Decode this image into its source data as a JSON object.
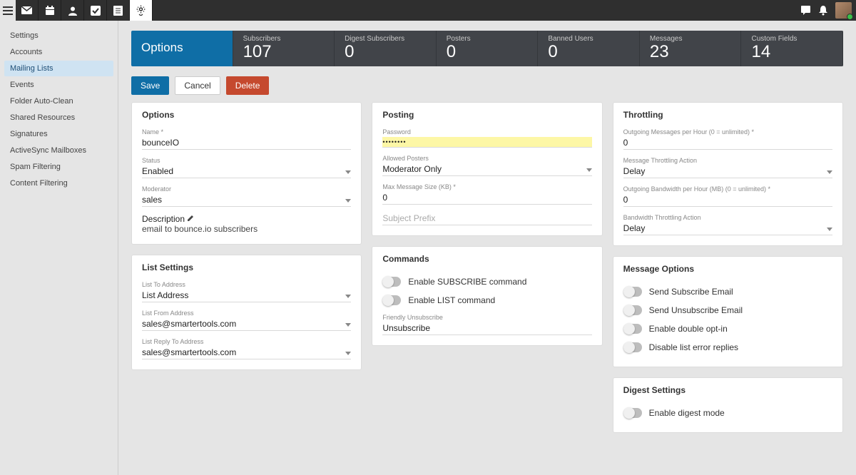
{
  "header": {
    "title": "Options",
    "stats": [
      {
        "label": "Subscribers",
        "value": "107"
      },
      {
        "label": "Digest Subscribers",
        "value": "0"
      },
      {
        "label": "Posters",
        "value": "0"
      },
      {
        "label": "Banned Users",
        "value": "0"
      },
      {
        "label": "Messages",
        "value": "23"
      },
      {
        "label": "Custom Fields",
        "value": "14"
      }
    ]
  },
  "actions": {
    "save": "Save",
    "cancel": "Cancel",
    "delete": "Delete"
  },
  "sidebar": {
    "items": [
      "Settings",
      "Accounts",
      "Mailing Lists",
      "Events",
      "Folder Auto-Clean",
      "Shared Resources",
      "Signatures",
      "ActiveSync Mailboxes",
      "Spam Filtering",
      "Content Filtering"
    ],
    "selectedIndex": 2
  },
  "options": {
    "title": "Options",
    "name_label": "Name *",
    "name": "bounceIO",
    "status_label": "Status",
    "status": "Enabled",
    "moderator_label": "Moderator",
    "moderator": "sales",
    "description_label": "Description",
    "description": "email to bounce.io subscribers"
  },
  "list": {
    "title": "List Settings",
    "to_label": "List To Address",
    "to": "List Address",
    "from_label": "List From Address",
    "from": "sales@smartertools.com",
    "reply_label": "List Reply To Address",
    "reply": "sales@smartertools.com"
  },
  "posting": {
    "title": "Posting",
    "password_label": "Password",
    "password": "••••••••",
    "posters_label": "Allowed Posters",
    "posters": "Moderator Only",
    "max_label": "Max Message Size (KB) *",
    "max": "0",
    "prefix_label": "",
    "prefix_placeholder": "Subject Prefix"
  },
  "commands": {
    "title": "Commands",
    "subscribe": "Enable SUBSCRIBE command",
    "list": "Enable LIST command",
    "friendly_label": "Friendly Unsubscribe",
    "friendly": "Unsubscribe"
  },
  "throttling": {
    "title": "Throttling",
    "out_msg_label": "Outgoing Messages per Hour (0 = unlimited) *",
    "out_msg": "0",
    "msg_action_label": "Message Throttling Action",
    "msg_action": "Delay",
    "out_bw_label": "Outgoing Bandwidth per Hour (MB) (0 = unlimited) *",
    "out_bw": "0",
    "bw_action_label": "Bandwidth Throttling Action",
    "bw_action": "Delay"
  },
  "msgopts": {
    "title": "Message Options",
    "t1": "Send Subscribe Email",
    "t2": "Send Unsubscribe Email",
    "t3": "Enable double opt-in",
    "t4": "Disable list error replies"
  },
  "digest": {
    "title": "Digest Settings",
    "t1": "Enable digest mode"
  }
}
